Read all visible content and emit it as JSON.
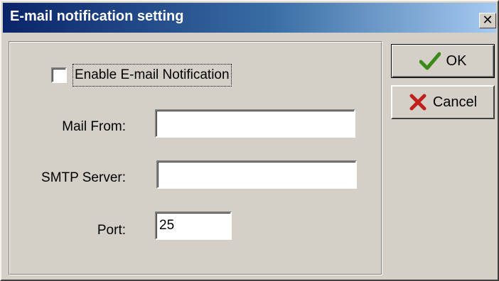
{
  "window": {
    "title": "E-mail notification setting",
    "close_glyph": "✕"
  },
  "form": {
    "enable_label": "Enable E-mail Notification",
    "enable_checked": false,
    "mail_from_label": "Mail From:",
    "mail_from_value": "",
    "smtp_server_label": "SMTP Server:",
    "smtp_server_value": "",
    "port_label": "Port:",
    "port_value": "25"
  },
  "buttons": {
    "ok_label": "OK",
    "ok_icon": "checkmark-icon",
    "cancel_label": "Cancel",
    "cancel_icon": "x-mark-icon"
  },
  "colors": {
    "titlebar_start": "#0a246a",
    "titlebar_end": "#a6caf0",
    "dialog_face": "#d4d0c8",
    "ok_icon_color": "#3a8a1a",
    "cancel_icon_color": "#c0201a"
  }
}
